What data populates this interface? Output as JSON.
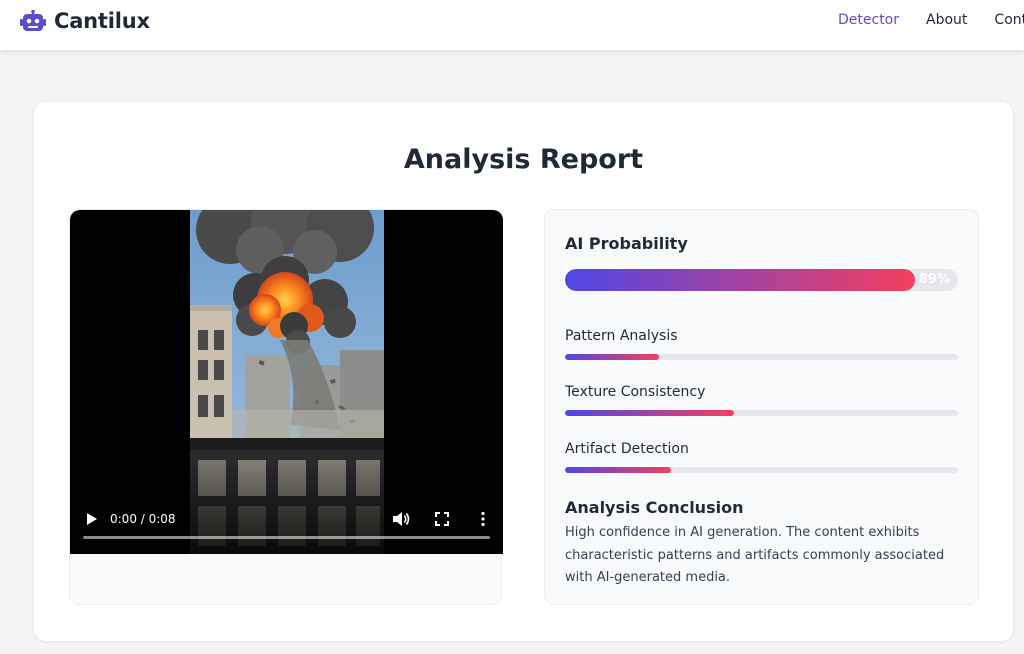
{
  "nav": {
    "brand": "Cantilux",
    "brand_icon": "robot-icon",
    "links": [
      {
        "label": "Detector",
        "active": true
      },
      {
        "label": "About",
        "active": false
      },
      {
        "label": "Contact",
        "active": false
      }
    ]
  },
  "report": {
    "title": "Analysis Report",
    "video": {
      "time": "0:00 / 0:08",
      "icons": [
        "play-icon",
        "volume-icon",
        "fullscreen-icon",
        "more-options-icon"
      ]
    },
    "ai_probability": {
      "label": "AI Probability",
      "value": 89,
      "display": "89%"
    },
    "metrics": [
      {
        "label": "Pattern Analysis",
        "value": 24
      },
      {
        "label": "Texture Consistency",
        "value": 43
      },
      {
        "label": "Artifact Detection",
        "value": 27
      }
    ],
    "conclusion": {
      "heading": "Analysis Conclusion",
      "text": "High confidence in AI generation. The content exhibits characteristic patterns and artifacts commonly associated with AI-generated media."
    }
  },
  "colors": {
    "accent": "#5b4bd6",
    "gradient_start": "#4f46e5",
    "gradient_end": "#f43f5e"
  }
}
